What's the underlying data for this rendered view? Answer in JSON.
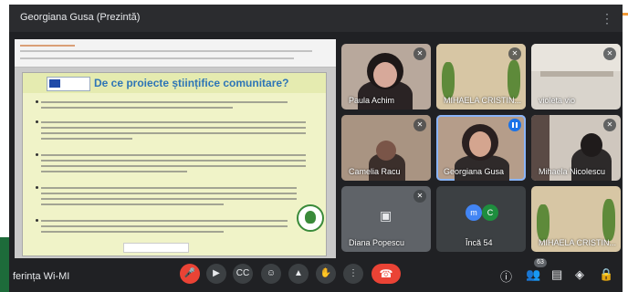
{
  "window": {
    "title": "Georgiana Gusa (Prezintă)"
  },
  "share": {
    "slide_title": "De ce proiecte științifice comunitare?"
  },
  "participants": [
    {
      "name": "Paula Achim",
      "muted": true
    },
    {
      "name": "MIHAELA CRISTIN...",
      "muted": true
    },
    {
      "name": "violeta vio",
      "muted": true
    },
    {
      "name": "Camelia Racu",
      "muted": true
    },
    {
      "name": "Georgiana Gusa",
      "muted": false,
      "speaking": true
    },
    {
      "name": "Mihaela Nicolescu",
      "muted": true
    },
    {
      "name": "Diana Popescu",
      "muted": true
    },
    {
      "name": "Încă 54",
      "avatars": [
        "m",
        "C"
      ]
    },
    {
      "name": "MIHAELA CRISTIN...",
      "muted": false
    }
  ],
  "bottom": {
    "meeting_label": "ferința Wi-MI",
    "people_count": "63"
  },
  "icons": {
    "mic": "mic-off-icon",
    "camera": "camera-icon",
    "captions": "captions-icon",
    "emoji": "emoji-icon",
    "present": "present-icon",
    "hand": "raise-hand-icon",
    "more": "more-options-icon",
    "end": "end-call-icon",
    "info": "info-icon",
    "people": "people-icon",
    "chat": "chat-icon",
    "activities": "activities-icon",
    "host": "host-controls-icon"
  },
  "colors": {
    "accent": "#ea4335",
    "background": "#202124",
    "speaking": "#1a73e8"
  }
}
